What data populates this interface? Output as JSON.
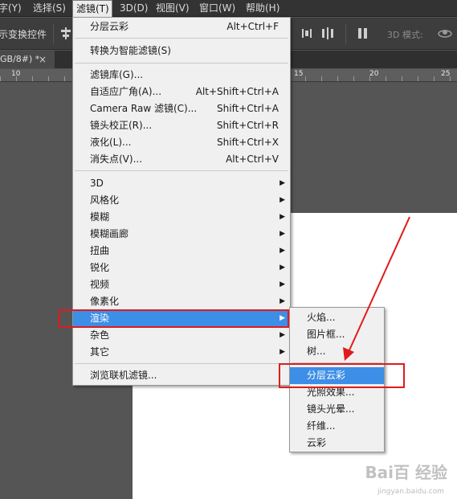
{
  "menubar": {
    "items": [
      {
        "label": "字(Y)"
      },
      {
        "label": "选择(S)"
      },
      {
        "label": "滤镜(T)"
      },
      {
        "label": "3D(D)"
      },
      {
        "label": "视图(V)"
      },
      {
        "label": "窗口(W)"
      },
      {
        "label": "帮助(H)"
      }
    ]
  },
  "options_bar": {
    "transform_controls_label": "示变换控件",
    "mode_label": "3D 模式:"
  },
  "document_tab": {
    "title": "GB/8#) *",
    "close": "×"
  },
  "ruler": {
    "labels": [
      "10",
      "15",
      "20",
      "25"
    ]
  },
  "filter_menu": {
    "items": [
      {
        "label": "分层云彩",
        "shortcut": "Alt+Ctrl+F"
      },
      {
        "label": "转换为智能滤镜(S)"
      },
      {
        "label": "滤镜库(G)..."
      },
      {
        "label": "自适应广角(A)...",
        "shortcut": "Alt+Shift+Ctrl+A"
      },
      {
        "label": "Camera Raw 滤镜(C)...",
        "shortcut": "Shift+Ctrl+A"
      },
      {
        "label": "镜头校正(R)...",
        "shortcut": "Shift+Ctrl+R"
      },
      {
        "label": "液化(L)...",
        "shortcut": "Shift+Ctrl+X"
      },
      {
        "label": "消失点(V)...",
        "shortcut": "Alt+Ctrl+V"
      },
      {
        "label": "3D",
        "submenu": true
      },
      {
        "label": "风格化",
        "submenu": true
      },
      {
        "label": "模糊",
        "submenu": true
      },
      {
        "label": "模糊画廊",
        "submenu": true
      },
      {
        "label": "扭曲",
        "submenu": true
      },
      {
        "label": "锐化",
        "submenu": true
      },
      {
        "label": "视频",
        "submenu": true
      },
      {
        "label": "像素化",
        "submenu": true
      },
      {
        "label": "渲染",
        "submenu": true,
        "highlighted": true
      },
      {
        "label": "杂色",
        "submenu": true
      },
      {
        "label": "其它",
        "submenu": true
      },
      {
        "label": "浏览联机滤镜..."
      }
    ]
  },
  "render_submenu": {
    "items": [
      {
        "label": "火焰..."
      },
      {
        "label": "图片框..."
      },
      {
        "label": "树..."
      },
      {
        "label": "分层云彩",
        "highlighted": true
      },
      {
        "label": "光照效果..."
      },
      {
        "label": "镜头光晕..."
      },
      {
        "label": "纤维..."
      },
      {
        "label": "云彩"
      }
    ]
  },
  "watermark": {
    "brand": "Bai百 经验",
    "url": "jingyan.baidu.com"
  },
  "colors": {
    "menu_highlight": "#3d8ee6",
    "annotation_red": "#e01b1b",
    "workspace": "#555555"
  }
}
